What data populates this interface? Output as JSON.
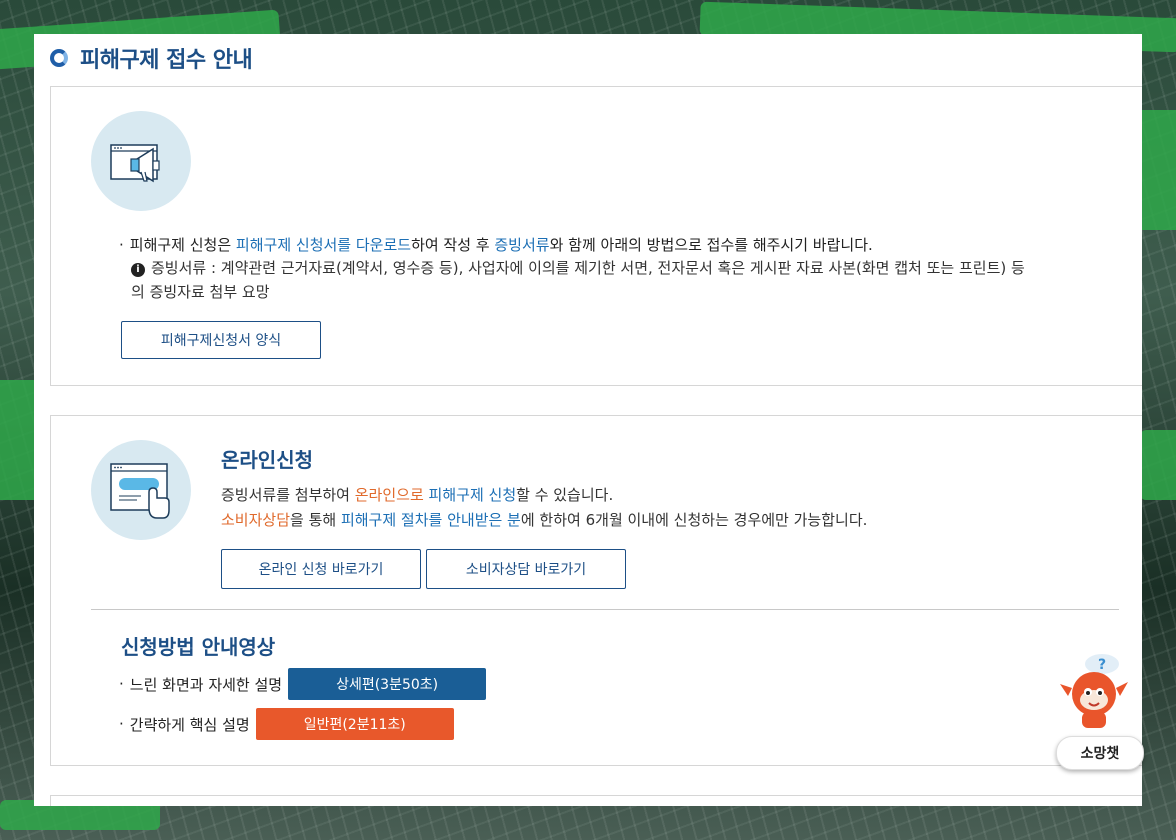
{
  "page": {
    "title": "피해구제 접수 안내"
  },
  "section1": {
    "intro_prefix": "피해구제 신청은 ",
    "intro_link1": "피해구제 신청서를 다운로드",
    "intro_mid": "하여 작성 후 ",
    "intro_link2": "증빙서류",
    "intro_suffix": "와 함께 아래의 방법으로 접수를 해주시기 바랍니다.",
    "note_line1": "증빙서류 : 계약관련 근거자료(계약서, 영수증 등), 사업자에 이의를 제기한 서면, 전자문서 혹은 게시판 자료 사본(화면 캡처 또는 프린트) 등",
    "note_line2": "의 증빙자료 첨부 요망",
    "form_button": "피해구제신청서 양식"
  },
  "section2": {
    "title": "온라인신청",
    "line1_prefix": "증빙서류를 첨부하여 ",
    "line1_hl1": "온라인으로",
    "line1_sp": " ",
    "line1_hl2": "피해구제 신청",
    "line1_suffix": "할 수 있습니다.",
    "line2_hl1": "소비자상담",
    "line2_mid": "을 통해 ",
    "line2_hl2": "피해구제 절차를 안내받은 분",
    "line2_suffix": "에 한하여 6개월 이내에 신청하는 경우에만 가능합니다.",
    "btn_online": "온라인 신청 바로가기",
    "btn_counsel": "소비자상담 바로가기",
    "video_title": "신청방법 안내영상",
    "video1_label": "느린 화면과 자세한 설명",
    "video1_button": "상세편(3분50초)",
    "video2_label": "간략하게 핵심 설명",
    "video2_button": "일반편(2분11초)"
  },
  "chatbot": {
    "label": "소망챗"
  },
  "colors": {
    "primary": "#1d4f86",
    "link": "#1c6fb5",
    "accent": "#e06a2c",
    "detail_btn": "#1a5e96",
    "general_btn": "#e8582b"
  },
  "icons": [
    "ring-icon",
    "megaphone-window-icon",
    "click-window-icon",
    "info-icon",
    "chatbot-mascot-icon"
  ]
}
